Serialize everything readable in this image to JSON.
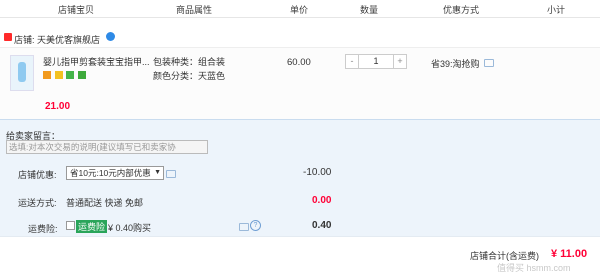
{
  "header": {
    "col_shop_item": "店铺宝贝",
    "col_attrs": "商品属性",
    "col_price": "单价",
    "col_qty": "数量",
    "col_discount": "优惠方式",
    "col_subtotal": "小计"
  },
  "shop": {
    "label": "店铺:",
    "name": "天美优客旗舰店"
  },
  "item": {
    "title": "婴儿指甲剪套装宝宝指甲...",
    "attr1": "包装种类：组合装",
    "attr2": "颜色分类：天蓝色",
    "price": "60.00",
    "quantity": "1",
    "minus": "-",
    "plus": "+",
    "discount": "省39:淘抢购",
    "subtotal": "21.00"
  },
  "message": {
    "label": "给卖家留言：",
    "placeholder": "选填:对本次交易的说明(建议填写已和卖家协"
  },
  "shop_discount": {
    "label": "店铺优惠:",
    "selected": "省10元:10元内部优惠",
    "amount": "-10.00"
  },
  "shipping": {
    "label": "运送方式:",
    "method": "普通配送 快递 免邮",
    "amount": "0.00"
  },
  "insurance": {
    "label": "运费险:",
    "tag": "运费险",
    "price": "¥ 0.40购买",
    "amount": "0.40"
  },
  "footer": {
    "label": "店铺合计(含运费)",
    "total": "¥ 11.00"
  },
  "watermark": "值得买 hsmm.com"
}
